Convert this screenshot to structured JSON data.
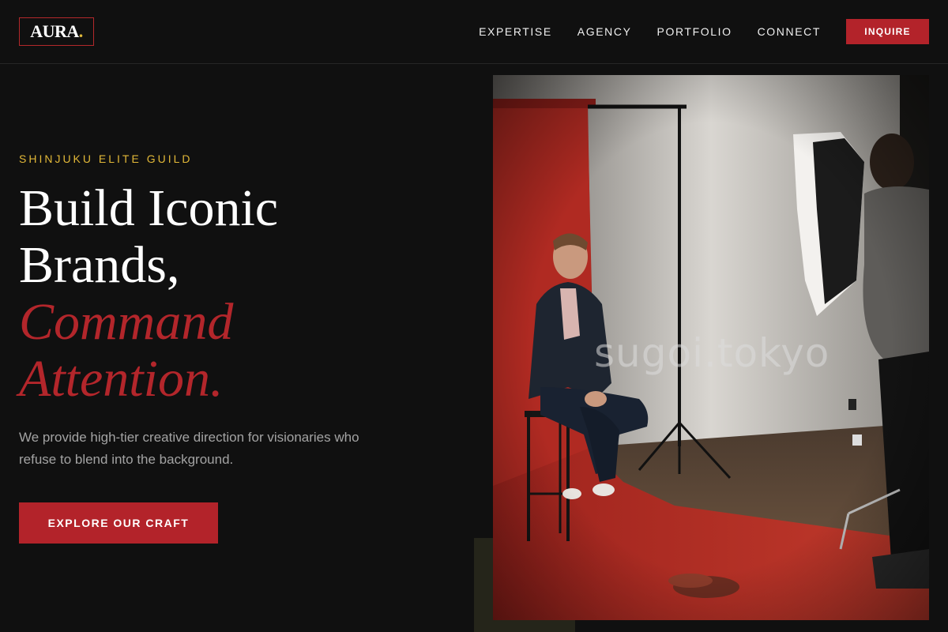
{
  "brand": {
    "name": "AURA",
    "dot": ".",
    "accent_color": "#e0b93a"
  },
  "nav": {
    "links": [
      "EXPERTISE",
      "AGENCY",
      "PORTFOLIO",
      "CONNECT"
    ],
    "cta_label": "INQUIRE"
  },
  "hero": {
    "eyebrow": "SHINJUKU ELITE GUILD",
    "headline_line1": "Build Iconic",
    "headline_line2": "Brands,",
    "headline_accent1": "Command",
    "headline_accent2": "Attention.",
    "subtext": "We provide high-tier creative direction for visionaries who refuse to blend into the background.",
    "cta_label": "EXPLORE OUR CRAFT"
  },
  "photo": {
    "watermark": "sugoi.tokyo",
    "subject": "man seated on stool in photo studio with red backdrop"
  },
  "colors": {
    "background": "#101010",
    "primary_red": "#b3232a",
    "gold": "#e2b838",
    "muted_text": "#a3a3a3"
  }
}
